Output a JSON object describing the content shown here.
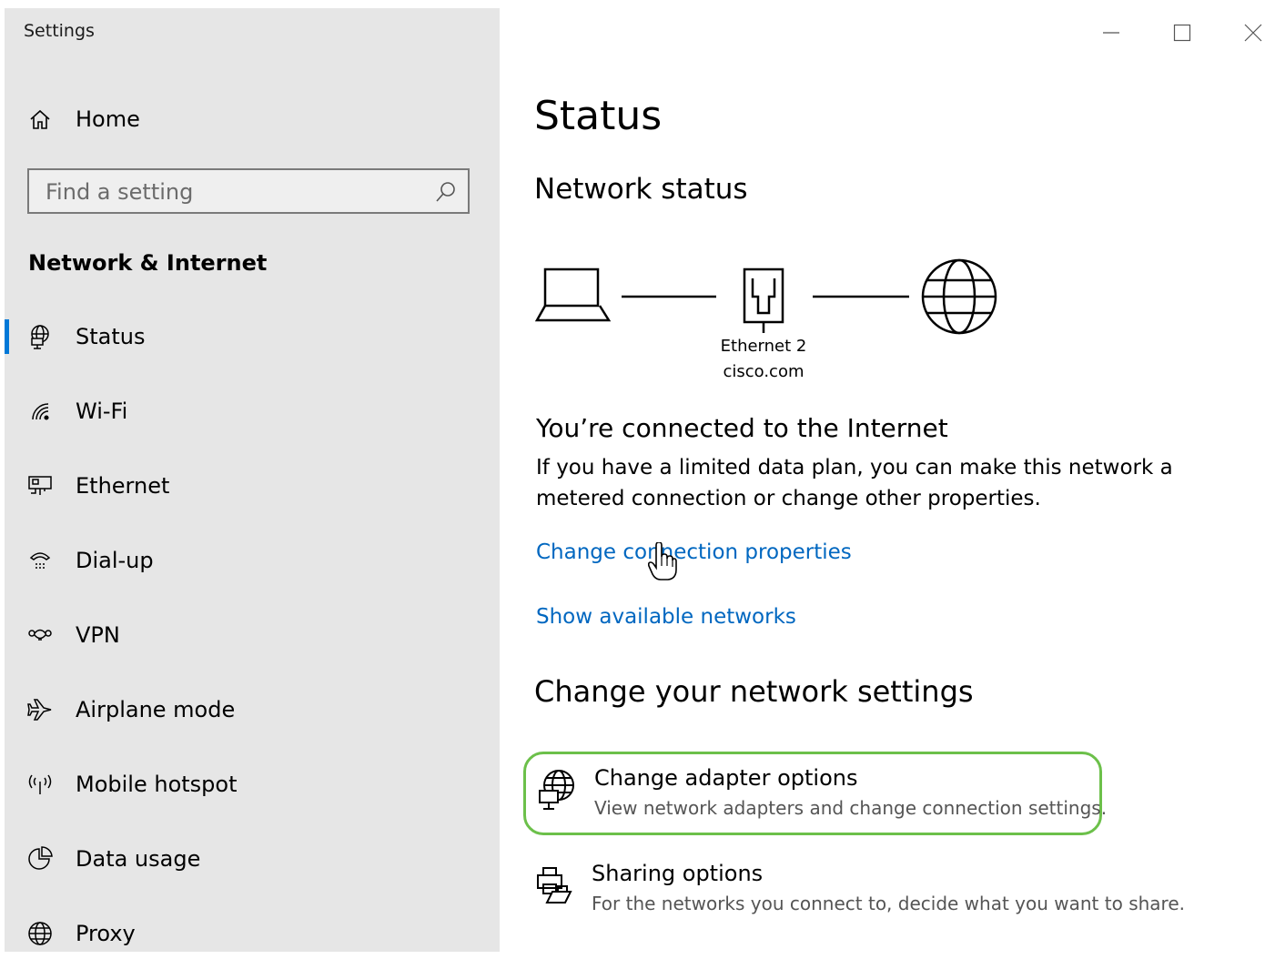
{
  "window": {
    "title": "Settings",
    "controls": [
      "minimize-icon",
      "maximize-icon",
      "close-icon"
    ]
  },
  "sidebar": {
    "home_label": "Home",
    "search": {
      "placeholder": "Find a setting",
      "value": ""
    },
    "section_title": "Network & Internet",
    "items": [
      {
        "label": "Status",
        "icon": "status-globe-icon",
        "active": true
      },
      {
        "label": "Wi-Fi",
        "icon": "wifi-icon"
      },
      {
        "label": "Ethernet",
        "icon": "ethernet-icon"
      },
      {
        "label": "Dial-up",
        "icon": "dialup-icon"
      },
      {
        "label": "VPN",
        "icon": "vpn-icon"
      },
      {
        "label": "Airplane mode",
        "icon": "airplane-icon"
      },
      {
        "label": "Mobile hotspot",
        "icon": "hotspot-icon"
      },
      {
        "label": "Data usage",
        "icon": "data-usage-icon"
      },
      {
        "label": "Proxy",
        "icon": "proxy-globe-icon"
      }
    ]
  },
  "main": {
    "title": "Status",
    "network_status_title": "Network status",
    "diagram": {
      "adapter_name": "Ethernet 2",
      "domain": "cisco.com"
    },
    "connection_heading": "You’re connected to the Internet",
    "connection_desc": "If you have a limited data plan, you can make this network a metered connection or change other properties.",
    "links": {
      "change_properties": "Change connection properties",
      "show_networks": "Show available networks"
    },
    "change_settings_title": "Change your network settings",
    "options": [
      {
        "title": "Change adapter options",
        "desc": "View network adapters and change connection settings.",
        "icon": "adapter-globe-icon",
        "highlighted": true
      },
      {
        "title": "Sharing options",
        "desc": "For the networks you connect to, decide what you want to share.",
        "icon": "sharing-printer-icon"
      }
    ],
    "accent_color": "#0067c0",
    "highlight_color": "#6cc04a"
  }
}
